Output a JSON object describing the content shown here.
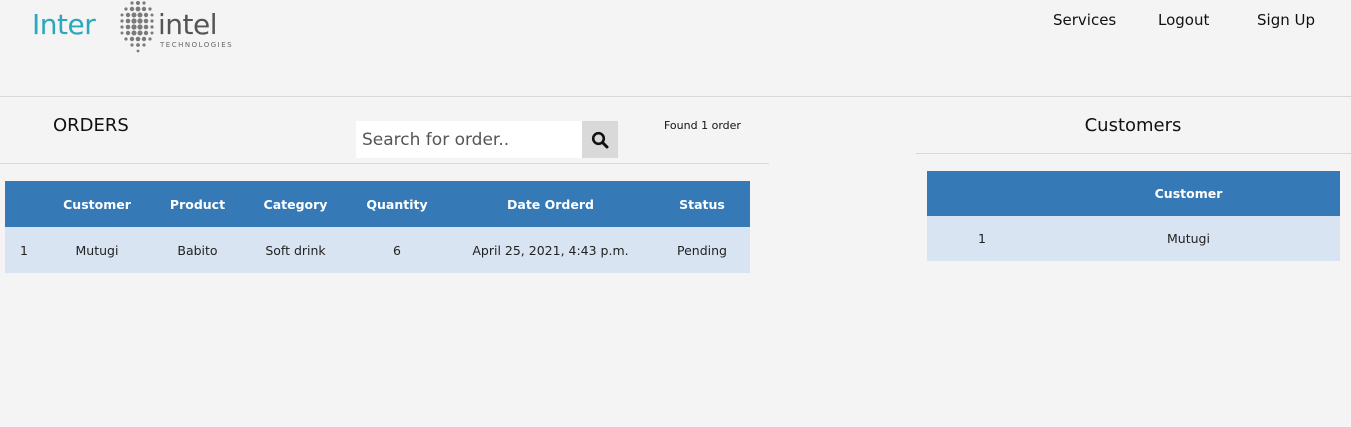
{
  "header": {
    "logo": {
      "left_text": "Inter",
      "right_text": "intel",
      "tagline": "TECHNOLOGIES",
      "left_color": "#2aa8bd",
      "right_color": "#555555"
    },
    "nav": {
      "services": "Services",
      "logout": "Logout",
      "signup": "Sign Up"
    }
  },
  "orders": {
    "title": "ORDERS",
    "search": {
      "placeholder": "Search for order..",
      "value": "",
      "icon": "search-icon"
    },
    "found_text": "Found 1 order",
    "columns": [
      "",
      "Customer",
      "Product",
      "Category",
      "Quantity",
      "Date Orderd",
      "Status"
    ],
    "rows": [
      [
        "1",
        "Mutugi",
        "Babito",
        "Soft drink",
        "6",
        "April 25, 2021, 4:43 p.m.",
        "Pending"
      ]
    ]
  },
  "customers": {
    "title": "Customers",
    "columns": [
      "",
      "Customer"
    ],
    "rows": [
      [
        "1",
        "Mutugi"
      ]
    ]
  },
  "colors": {
    "background": "#f4f4f4",
    "table_header": "#3579b6",
    "table_row": "#d8e4f2",
    "brand_teal": "#2aa8bd"
  }
}
